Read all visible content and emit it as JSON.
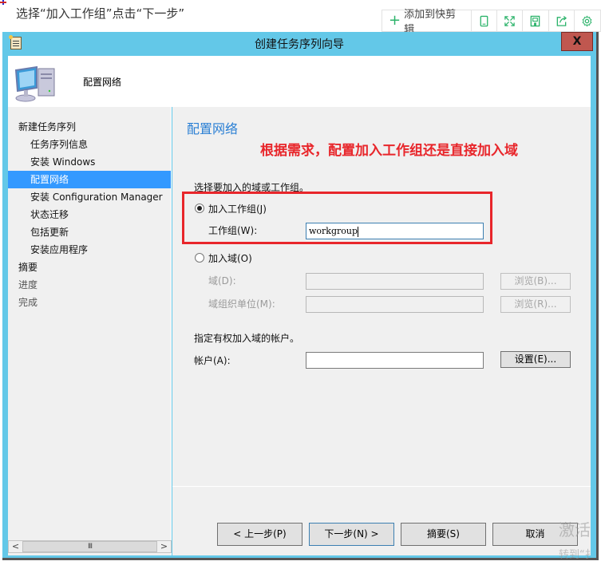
{
  "annotation_title": "选择“加入工作组”点击“下一步”",
  "clip_toolbar": {
    "add_label": "添加到快剪辑",
    "icons": [
      "phone-icon",
      "expand-icon",
      "save-icon",
      "share-icon",
      "settings-icon"
    ]
  },
  "window": {
    "title": "创建任务序列向导",
    "close_label": "X",
    "header_text": "配置网络"
  },
  "sidebar": {
    "items": [
      {
        "label": "新建任务序列",
        "level": 0,
        "state": "normal"
      },
      {
        "label": "任务序列信息",
        "level": 1,
        "state": "normal"
      },
      {
        "label": "安装 Windows",
        "level": 1,
        "state": "normal"
      },
      {
        "label": "配置网络",
        "level": 1,
        "state": "active"
      },
      {
        "label": "安装 Configuration Manager",
        "level": 1,
        "state": "normal"
      },
      {
        "label": "状态迁移",
        "level": 1,
        "state": "normal"
      },
      {
        "label": "包括更新",
        "level": 1,
        "state": "normal"
      },
      {
        "label": "安装应用程序",
        "level": 1,
        "state": "normal"
      },
      {
        "label": "摘要",
        "level": 0,
        "state": "normal"
      },
      {
        "label": "进度",
        "level": 0,
        "state": "disabled"
      },
      {
        "label": "完成",
        "level": 0,
        "state": "disabled"
      }
    ],
    "scroll_left": "<",
    "scroll_right": ">",
    "scroll_thumb": "III"
  },
  "content": {
    "page_title": "配置网络",
    "annotation": "根据需求，配置加入工作组还是直接加入域",
    "choose_label": "选择要加入的域或工作组。",
    "workgroup_radio": {
      "label": "加入工作组(J)",
      "checked": true
    },
    "workgroup_field": {
      "label": "工作组(W):",
      "value": "workgroup"
    },
    "domain_radio": {
      "label": "加入域(O)",
      "checked": false
    },
    "domain_field": {
      "label": "域(D):",
      "value": "",
      "browse": "浏览(B)..."
    },
    "ou_field": {
      "label": "域组织单位(M):",
      "value": "",
      "browse": "浏览(R)..."
    },
    "account_hint": "指定有权加入域的帐户。",
    "account_field": {
      "label": "帐户(A):",
      "value": "",
      "set": "设置(E)..."
    }
  },
  "buttons": {
    "back": "< 上一步(P)",
    "next": "下一步(N) >",
    "summary": "摘要(S)",
    "cancel": "取消"
  },
  "watermark": {
    "line1": "激活",
    "line2": "转到“扌"
  },
  "colors": {
    "window_frame": "#63c8e8",
    "close_button": "#c0574f",
    "nav_active": "#3399ff",
    "page_title": "#2a7fd4",
    "annotation_red": "#e8262b",
    "toolbar_green": "#2bb36a"
  }
}
